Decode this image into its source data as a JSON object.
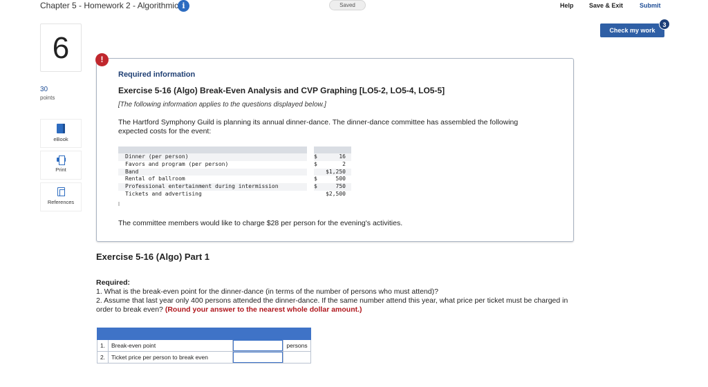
{
  "header": {
    "chapter_title": "Chapter 5 - Homework 2 - Algorithmic",
    "info_glyph": "i",
    "saved_status": "Saved",
    "help_label": "Help",
    "save_exit_label": "Save & Exit",
    "submit_label": "Submit",
    "check_my_work_label": "Check my work",
    "check_badge_count": "3"
  },
  "sidebar": {
    "question_number": "6",
    "points_value": "30",
    "points_label": "points",
    "tools": [
      {
        "label": "eBook",
        "icon": "book-icon"
      },
      {
        "label": "Print",
        "icon": "printer-icon"
      },
      {
        "label": "References",
        "icon": "document-icon"
      }
    ]
  },
  "info_panel": {
    "alert_glyph": "!",
    "required_information": "Required information",
    "exercise_title": "Exercise 5-16 (Algo) Break-Even Analysis and CVP Graphing [LO5-2, LO5-4, LO5-5]",
    "applies_note": "[The following information applies to the questions displayed below.]",
    "intro": "The Hartford Symphony Guild is planning its annual dinner-dance. The dinner-dance committee has assembled the following expected costs for the event:",
    "costs": [
      {
        "item": "Dinner (per person)",
        "currency": "$",
        "amount": "16"
      },
      {
        "item": "Favors and program (per person)",
        "currency": "$",
        "amount": "2"
      },
      {
        "item": "Band",
        "currency": "",
        "amount": "$1,250"
      },
      {
        "item": "Rental of ballroom",
        "currency": "$",
        "amount": "500"
      },
      {
        "item": "Professional entertainment during intermission",
        "currency": "$",
        "amount": "750"
      },
      {
        "item": "Tickets and advertising",
        "currency": "",
        "amount": "$2,500"
      }
    ],
    "charge_statement": "The committee members would like to charge $28 per person for the evening's activities."
  },
  "part": {
    "title": "Exercise 5-16 (Algo) Part 1",
    "required_label": "Required:",
    "question_1": "1. What is the break-even point for the dinner-dance (in terms of the number of persons who must attend)?",
    "question_2": "2. Assume that last year only 400 persons attended the dinner-dance. If the same number attend this year, what price per ticket must be charged in order to break even?",
    "round_note": "(Round your answer to the nearest whole dollar amount.)"
  },
  "answer_table": {
    "rows": [
      {
        "num": "1.",
        "label": "Break-even point",
        "value": "",
        "unit": "persons"
      },
      {
        "num": "2.",
        "label": "Ticket price per person to break even",
        "value": "",
        "unit": ""
      }
    ]
  },
  "colors": {
    "accent_blue": "#2f5fa5",
    "alert_red": "#c0272d",
    "round_note_red": "#b0181e"
  }
}
